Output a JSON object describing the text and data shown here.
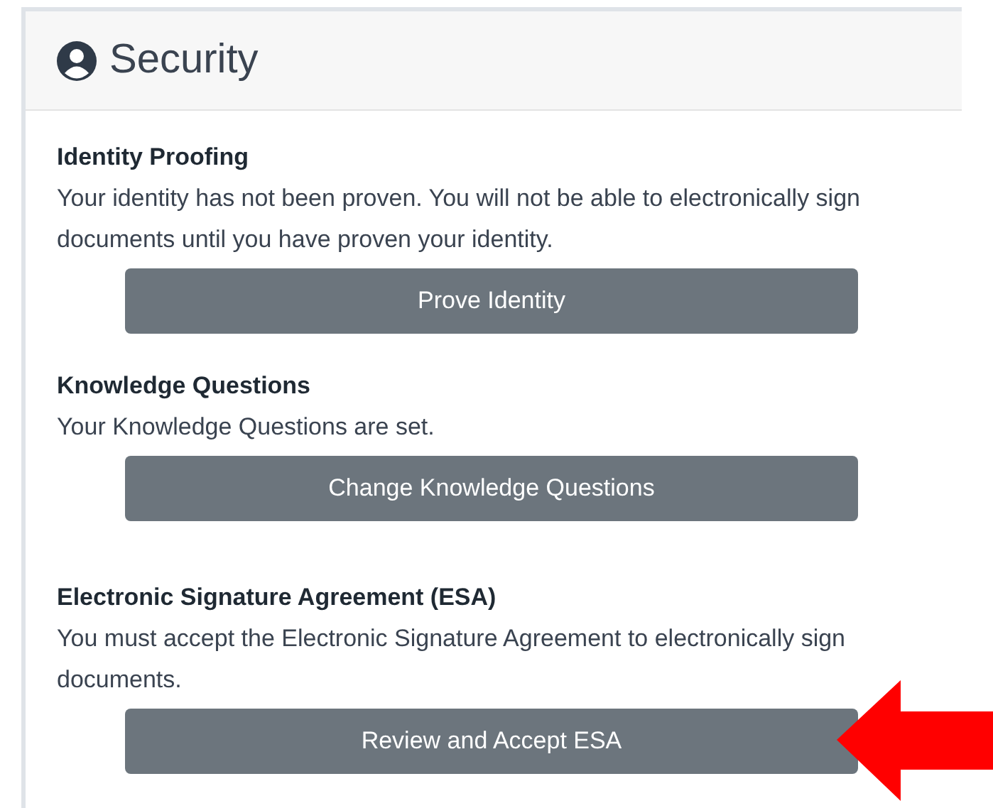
{
  "card": {
    "title": "Security"
  },
  "sections": [
    {
      "heading": "Identity Proofing",
      "text": "Your identity has not been proven. You will not be able to electronically sign documents until you have proven your identity.",
      "button": "Prove Identity"
    },
    {
      "heading": "Knowledge Questions",
      "text": "Your Knowledge Questions are set.",
      "button": "Change Knowledge Questions"
    },
    {
      "heading": "Electronic Signature Agreement (ESA)",
      "text": "You must accept the Electronic Signature Agreement to electronically sign documents.",
      "button": "Review and Accept ESA"
    }
  ]
}
